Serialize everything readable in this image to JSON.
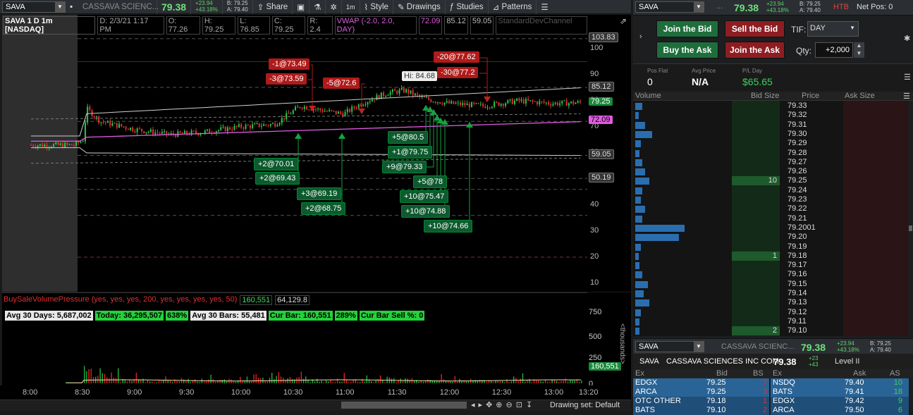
{
  "toolbar": {
    "symbol": "SAVA",
    "company": "CASSAVA SCIENC...",
    "last": "79.38",
    "change": "+23.94",
    "change_pct": "+43.18%",
    "bid": "B: 79.25",
    "ask": "A: 79.40",
    "share": "Share",
    "tf": "1m",
    "style": "Style",
    "drawings": "Drawings",
    "studies": "Studies",
    "patterns": "Patterns"
  },
  "chart": {
    "title": "SAVA 1 D 1m [NASDAQ]",
    "ohlc": "D: 2/3/21 1:17 PM",
    "open": "O: 77.26",
    "high": "H: 79.25",
    "low": "L: 76.85",
    "close": "C: 79.25",
    "range": "R: 2.4",
    "vwap": "VWAP (-2.0, 2.0, DAY)",
    "vwap_v": "72.09",
    "vwap_u": "85.12",
    "vwap_l": "59.05",
    "sd": "StandardDevChannel",
    "hi_label": "Hi: 84.68",
    "price_ticks": [
      "100",
      "90",
      "80",
      "70",
      "60",
      "50",
      "40",
      "30",
      "20",
      "10"
    ],
    "tags": {
      "top": "103.83",
      "upper": "85.12",
      "last": "79.25",
      "vwap": "72.09",
      "lower": "59.05",
      "low50": "50.19"
    },
    "sells": [
      "-1@73.49",
      "-3@73.59",
      "-5@72.6",
      "-20@77.62",
      "-30@77.2"
    ],
    "buys": [
      "+2@70.01",
      "+2@69.43",
      "+3@69.19",
      "+2@68.75",
      "+5@80.5",
      "+1@79.75",
      "+9@79.33",
      "+5@78",
      "+10@75.47",
      "+10@74.88",
      "+10@74.66"
    ]
  },
  "volume": {
    "study": "BuySaleVolumePressure (yes, yes, yes, 200, yes, yes, yes, yes, 50)",
    "v1": "160,551",
    "v2": "64,129.8",
    "avg30": "Avg 30 Days: 5,687,002",
    "today": "Today: 36,295,507",
    "pct1": "638%",
    "avgbars": "Avg 30 Bars: 55,481",
    "curbar": "Cur Bar: 160,551",
    "pct2": "289%",
    "sellpct": "Cur Bar Sell %: 0",
    "ticks": [
      "750",
      "500",
      "250",
      "0"
    ],
    "unit": "<thousands>",
    "tag": "160,551"
  },
  "xaxis": [
    "8:00",
    "8:30",
    "9:00",
    "9:30",
    "10:00",
    "10:30",
    "11:00",
    "11:30",
    "12:00",
    "12:30",
    "13:00",
    "13:20"
  ],
  "status": {
    "drawing_set": "Drawing set: Default"
  },
  "trade": {
    "symbol": "SAVA",
    "last": "79.38",
    "change": "+23.94",
    "change_pct": "+43.18%",
    "bid": "B: 79.25",
    "ask": "A: 79.40",
    "htb": "HTB",
    "netpos": "Net Pos: 0",
    "join_bid": "Join the Bid",
    "sell_bid": "Sell the Bid",
    "buy_ask": "Buy the Ask",
    "join_ask": "Join the Ask",
    "tif_label": "TIF:",
    "tif": "DAY",
    "qty_label": "Qty:",
    "qty": "+2,000",
    "posflat_l": "Pos Flat",
    "posflat": "0",
    "avgprice_l": "Avg Price",
    "avgprice": "N/A",
    "pl_l": "P/L Day",
    "pl": "$65.65"
  },
  "ladder": {
    "headers": [
      "Volume",
      "Bid Size",
      "Price",
      "Ask Size"
    ],
    "rows": [
      {
        "p": "79.33",
        "v": 10,
        "b": ""
      },
      {
        "p": "79.32",
        "v": 5,
        "b": ""
      },
      {
        "p": "79.31",
        "v": 14,
        "b": ""
      },
      {
        "p": "79.30",
        "v": 24,
        "b": ""
      },
      {
        "p": "79.29",
        "v": 8,
        "b": ""
      },
      {
        "p": "79.28",
        "v": 6,
        "b": ""
      },
      {
        "p": "79.27",
        "v": 10,
        "b": ""
      },
      {
        "p": "79.26",
        "v": 14,
        "b": ""
      },
      {
        "p": "79.25",
        "v": 20,
        "b": "10"
      },
      {
        "p": "79.24",
        "v": 10,
        "b": ""
      },
      {
        "p": "79.23",
        "v": 8,
        "b": ""
      },
      {
        "p": "79.22",
        "v": 14,
        "b": ""
      },
      {
        "p": "79.21",
        "v": 10,
        "b": ""
      },
      {
        "p": "79.2001",
        "v": 70,
        "b": ""
      },
      {
        "p": "79.20",
        "v": 62,
        "b": ""
      },
      {
        "p": "79.19",
        "v": 8,
        "b": ""
      },
      {
        "p": "79.18",
        "v": 5,
        "b": "1"
      },
      {
        "p": "79.17",
        "v": 6,
        "b": ""
      },
      {
        "p": "79.16",
        "v": 10,
        "b": ""
      },
      {
        "p": "79.15",
        "v": 18,
        "b": ""
      },
      {
        "p": "79.14",
        "v": 12,
        "b": ""
      },
      {
        "p": "79.13",
        "v": 20,
        "b": ""
      },
      {
        "p": "79.12",
        "v": 8,
        "b": ""
      },
      {
        "p": "79.11",
        "v": 6,
        "b": ""
      },
      {
        "p": "79.10",
        "v": 6,
        "b": "2"
      }
    ]
  },
  "level2": {
    "symbol": "SAVA",
    "company": "CASSAVA SCIENC...",
    "last": "79.38",
    "change": "+23.94",
    "change_pct": "+43.18%",
    "bid": "B: 79.25",
    "ask": "A: 79.40",
    "name_sym": "SAVA",
    "name": "CASSAVA SCIENCES INC COM",
    "name_last": "79.38",
    "name_chg1": "+23",
    "name_chg2": "+43",
    "level": "Level II",
    "bid_headers": [
      "Ex",
      "Bid",
      "BS"
    ],
    "ask_headers": [
      "Ex",
      "Ask",
      "AS"
    ],
    "bids": [
      [
        "EDGX",
        "79.25",
        "7"
      ],
      [
        "ARCA",
        "79.25",
        "3"
      ],
      [
        "OTC OTHER",
        "79.18",
        "1"
      ],
      [
        "BATS",
        "79.10",
        "2"
      ]
    ],
    "asks": [
      [
        "NSDQ",
        "79.40",
        "10"
      ],
      [
        "BATS",
        "79.41",
        "18"
      ],
      [
        "EDGX",
        "79.42",
        "9"
      ],
      [
        "ARCA",
        "79.50",
        "6"
      ]
    ]
  }
}
